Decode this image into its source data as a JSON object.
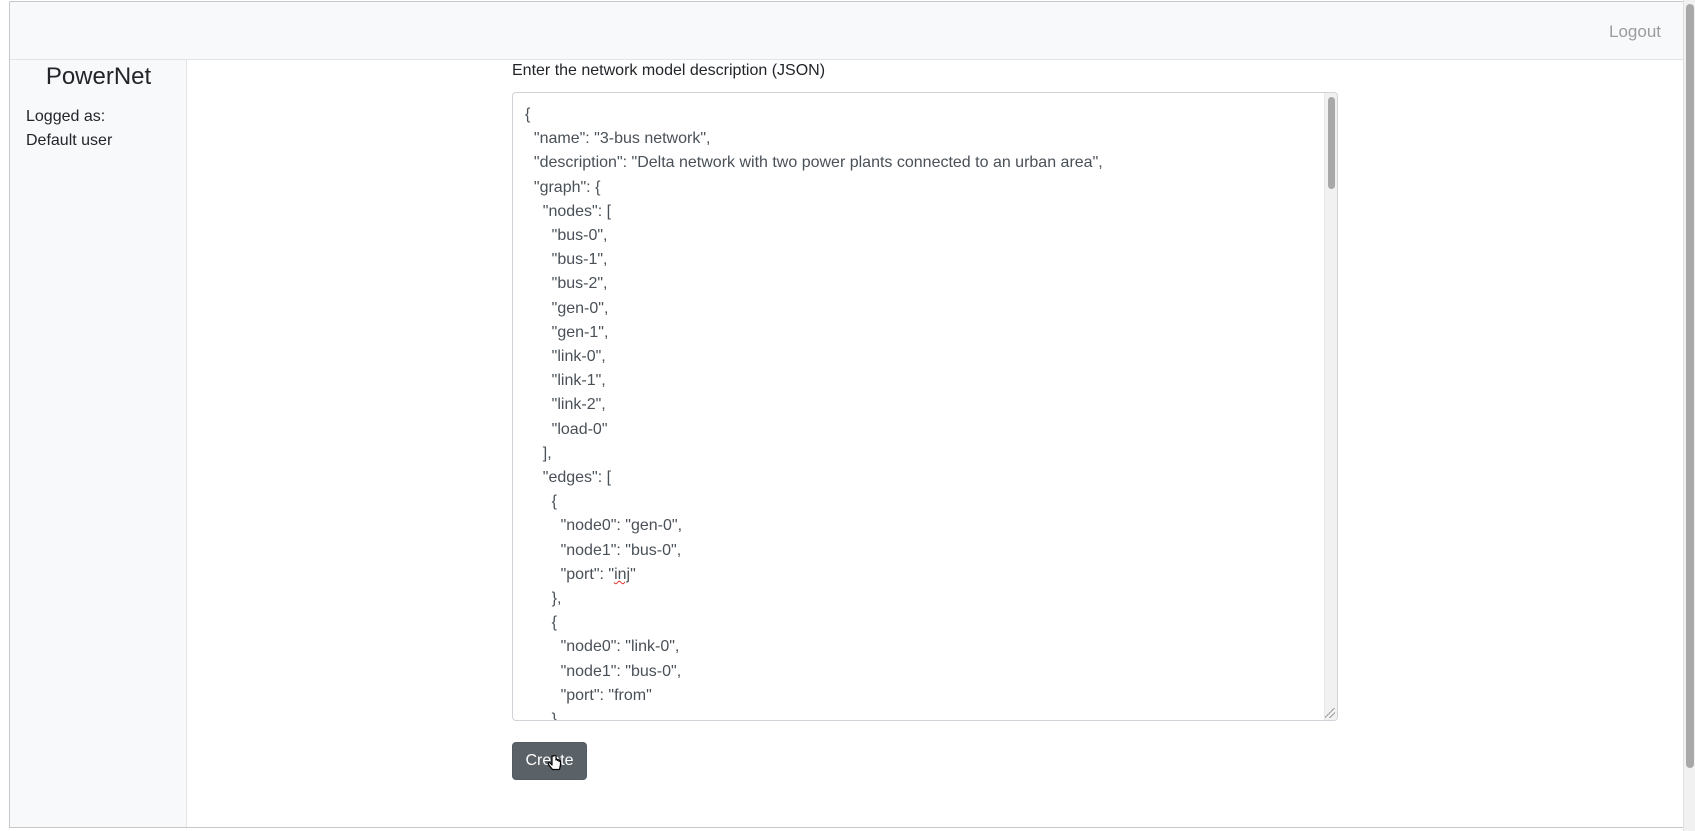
{
  "header": {
    "logout_label": "Logout"
  },
  "sidebar": {
    "brand": "PowerNet",
    "logged_label": "Logged as:",
    "user_name": "Default user"
  },
  "form": {
    "label": "Enter the network model description (JSON)",
    "json_lines": [
      "{",
      "  \"name\": \"3-bus network\",",
      "  \"description\": \"Delta network with two power plants connected to an urban area\",",
      "  \"graph\": {",
      "    \"nodes\": [",
      "      \"bus-0\",",
      "      \"bus-1\",",
      "      \"bus-2\",",
      "      \"gen-0\",",
      "      \"gen-1\",",
      "      \"link-0\",",
      "      \"link-1\",",
      "      \"link-2\",",
      "      \"load-0\"",
      "    ],",
      "    \"edges\": [",
      "      {",
      "        \"node0\": \"gen-0\",",
      "        \"node1\": \"bus-0\",",
      "        \"port\": \"inj\"",
      "      },",
      "      {",
      "        \"node0\": \"link-0\",",
      "        \"node1\": \"bus-0\",",
      "        \"port\": \"from\"",
      "      }"
    ],
    "create_label": "Create"
  }
}
